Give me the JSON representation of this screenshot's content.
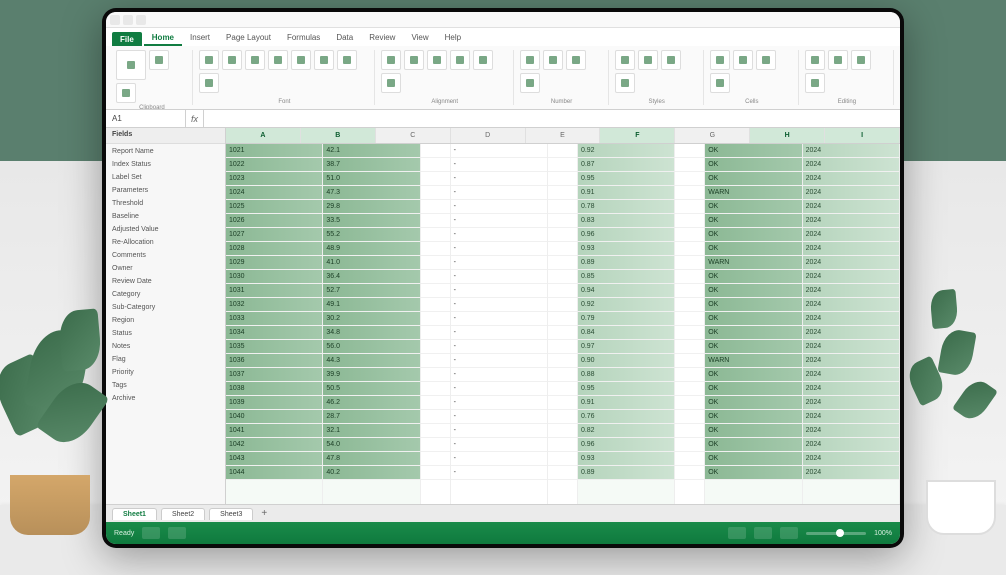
{
  "app": {
    "product": "Spreadsheet"
  },
  "ribbon": {
    "file": "File",
    "tabs": [
      "Home",
      "Insert",
      "Page Layout",
      "Formulas",
      "Data",
      "Review",
      "View",
      "Help"
    ],
    "active": 0,
    "groups": [
      "Clipboard",
      "Font",
      "Alignment",
      "Number",
      "Styles",
      "Cells",
      "Editing"
    ]
  },
  "formula": {
    "namebox": "A1",
    "fx": "fx",
    "content": ""
  },
  "sidebar": {
    "title": "Fields",
    "items": [
      "Report Name",
      "Index Status",
      "Label Set",
      "Parameters",
      "Threshold",
      "Baseline",
      "Adjusted Value",
      "Re-Allocation",
      "Comments",
      "Owner",
      "Review Date",
      "Category",
      "Sub-Category",
      "Region",
      "Status",
      "Notes",
      "Flag",
      "Priority",
      "Tags",
      "Archive"
    ]
  },
  "columns": [
    "A",
    "B",
    "C",
    "D",
    "E",
    "F",
    "G",
    "H",
    "I"
  ],
  "grid": {
    "colA": [
      "1021",
      "1022",
      "1023",
      "1024",
      "1025",
      "1026",
      "1027",
      "1028",
      "1029",
      "1030",
      "1031",
      "1032",
      "1033",
      "1034",
      "1035",
      "1036",
      "1037",
      "1038",
      "1039",
      "1040",
      "1041",
      "1042",
      "1043",
      "1044"
    ],
    "colB": [
      "42.1",
      "38.7",
      "51.0",
      "47.3",
      "29.8",
      "33.5",
      "55.2",
      "48.9",
      "41.0",
      "36.4",
      "52.7",
      "49.1",
      "30.2",
      "34.8",
      "56.0",
      "44.3",
      "39.9",
      "50.5",
      "46.2",
      "28.7",
      "32.1",
      "54.0",
      "47.8",
      "40.2"
    ],
    "colD": [
      "-",
      "-",
      "-",
      "-",
      "-",
      "-",
      "-",
      "-",
      "-",
      "-",
      "-",
      "-",
      "-",
      "-",
      "-",
      "-",
      "-",
      "-",
      "-",
      "-",
      "-",
      "-",
      "-",
      "-"
    ],
    "colF": [
      "0.92",
      "0.87",
      "0.95",
      "0.91",
      "0.78",
      "0.83",
      "0.96",
      "0.93",
      "0.89",
      "0.85",
      "0.94",
      "0.92",
      "0.79",
      "0.84",
      "0.97",
      "0.90",
      "0.88",
      "0.95",
      "0.91",
      "0.76",
      "0.82",
      "0.96",
      "0.93",
      "0.89"
    ],
    "colH": [
      "OK",
      "OK",
      "OK",
      "WARN",
      "OK",
      "OK",
      "OK",
      "OK",
      "WARN",
      "OK",
      "OK",
      "OK",
      "OK",
      "OK",
      "OK",
      "WARN",
      "OK",
      "OK",
      "OK",
      "OK",
      "OK",
      "OK",
      "OK",
      "OK"
    ],
    "colI": [
      "2024",
      "2024",
      "2024",
      "2024",
      "2024",
      "2024",
      "2024",
      "2024",
      "2024",
      "2024",
      "2024",
      "2024",
      "2024",
      "2024",
      "2024",
      "2024",
      "2024",
      "2024",
      "2024",
      "2024",
      "2024",
      "2024",
      "2024",
      "2024"
    ]
  },
  "sheets": {
    "tabs": [
      "Sheet1",
      "Sheet2",
      "Sheet3"
    ],
    "active": 0,
    "add": "+"
  },
  "status": {
    "ready": "Ready",
    "zoom": "100%"
  }
}
